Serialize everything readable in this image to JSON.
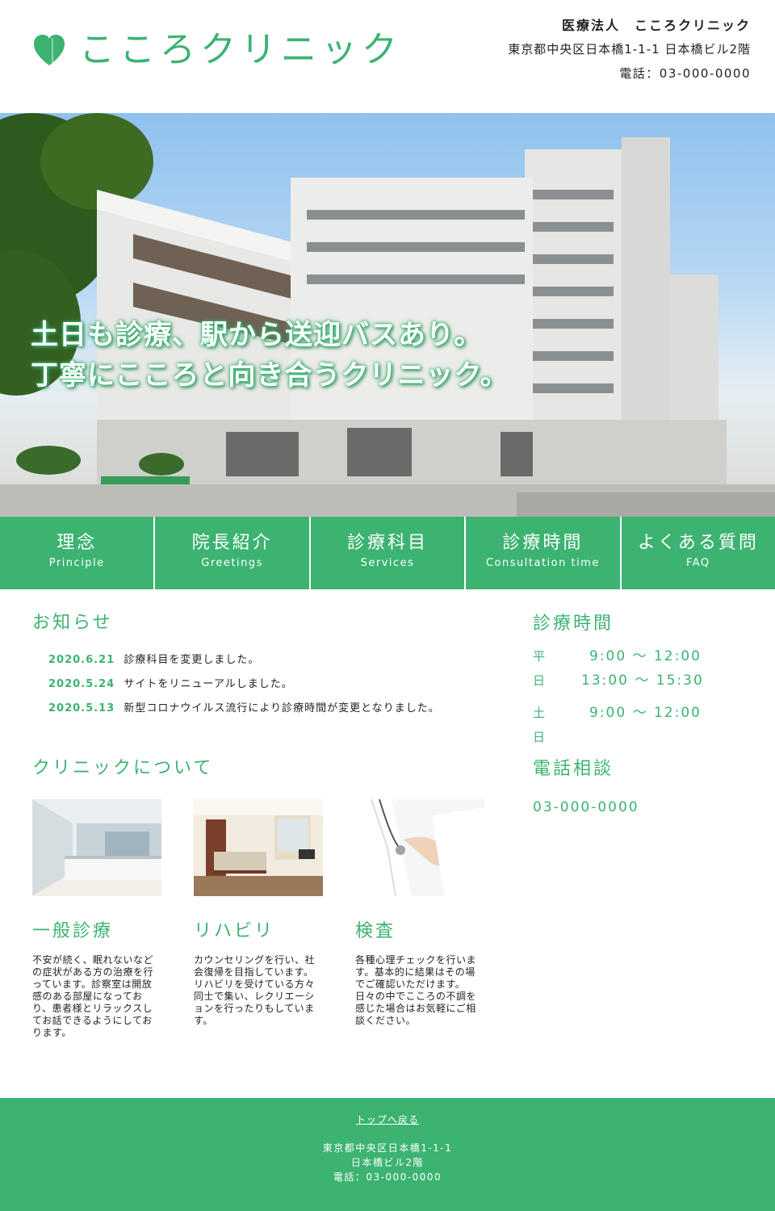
{
  "header": {
    "logo_text": "こころクリニック",
    "corp_name": "医療法人　こころクリニック",
    "address": "東京都中央区日本橋1-1-1 日本橋ビル2階",
    "tel": "電話：03-000-0000"
  },
  "hero": {
    "line1": "土日も診療、駅から送迎バスあり。",
    "line2": "丁寧にこころと向き合うクリニック。"
  },
  "nav": [
    {
      "jp": "理念",
      "en": "Principle"
    },
    {
      "jp": "院長紹介",
      "en": "Greetings"
    },
    {
      "jp": "診療科目",
      "en": "Services"
    },
    {
      "jp": "診療時間",
      "en": "Consultation time"
    },
    {
      "jp": "よくある質問",
      "en": "FAQ"
    }
  ],
  "news": {
    "title": "お知らせ",
    "items": [
      {
        "date": "2020.6.21",
        "text": "診療科目を変更しました。"
      },
      {
        "date": "2020.5.24",
        "text": "サイトをリニューアルしました。"
      },
      {
        "date": "2020.5.13",
        "text": "新型コロナウイルス流行により診療時間が変更となりました。"
      }
    ]
  },
  "hours": {
    "title": "診療時間",
    "weekday_label": "平日",
    "weekday_am": "9:00 ～ 12:00",
    "weekday_pm": "13:00 ～ 15:30",
    "weekend_label": "土日",
    "weekend_am": "9:00 ～ 12:00"
  },
  "phone_consult": {
    "title": "電話相談",
    "number": "03-000-0000"
  },
  "about": {
    "title": "クリニックについて",
    "cards": [
      {
        "title": "一般診療",
        "text": "不安が続く、眠れないなどの症状がある方の治療を行っています。診察室は開放感のある部屋になっており、患者様とリラックスしてお話できるようにしております。"
      },
      {
        "title": "リハビリ",
        "text": "カウンセリングを行い、社会復帰を目指しています。リハビリを受けている方々同士で集い、レクリエーションを行ったりもしています。"
      },
      {
        "title": "検査",
        "text": "各種心理チェックを行います。基本的に結果はその場でご確認いただけます。日々の中でこころの不調を感じた場合はお気軽にご相談ください。"
      }
    ]
  },
  "footer": {
    "back_to_top": "トップへ戻る",
    "address1": "東京都中央区日本橋1-1-1",
    "address2": "日本橋ビル2階",
    "tel": "電話：03-000-0000"
  },
  "colors": {
    "accent": "#3cb371"
  }
}
